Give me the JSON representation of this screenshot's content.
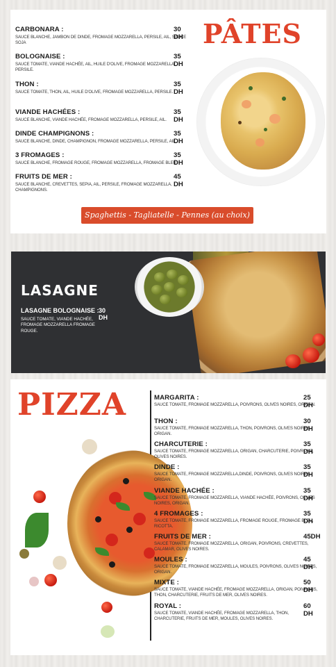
{
  "pates": {
    "title": "PÂTES",
    "items": [
      {
        "name": "CARBONARA :",
        "price": "30 DH",
        "desc": "SAUCE BLANCHE, JAMBON DE DINDE, FROMAGE MOZZARELLA, PERSILE, AIL, SAUCE SOJA"
      },
      {
        "name": "BOLOGNAISE :",
        "price": "35 DH",
        "desc": "SAUCE TOMATE, VIANDE HACHÉE, AIL, HUILE D'OLIVE, FROMAGE MOZZARELLA, PERSILE."
      },
      {
        "name": "THON :",
        "price": "35 DH",
        "desc": "SAUCE TOMATE, THON, AIL, HUILE D'OLIVE, FROMAGE MOZZARELLA, PERSILE."
      },
      {
        "name": "VIANDE HACHÉES :",
        "price": "35 DH",
        "desc": "SAUCE BLANCHE, VIANDE HACHÉE, FROMAGE MOZZARELLA, PERSILE, AIL."
      },
      {
        "name": "DINDE CHAMPIGNONS :",
        "price": "35 DH",
        "desc": "SAUCE BLANCHE, DINDE, CHAMPIGNON, FROMAGE MOZZARELLA, PERSILE, AIL."
      },
      {
        "name": "3 FROMAGES :",
        "price": "35 DH",
        "desc": "SAUCE BLANCHE, FROMAGE ROUGE, FROMAGE MOZZARELLA, FROMAGE BLEU."
      },
      {
        "name": "FRUITS DE MER :",
        "price": "45 DH",
        "desc": "SAUCE BLANCHE, CREVETTES, SEPIA, AIL, PERSILE, FROMAGE MOZZARELLA, CHAMPIGNONS."
      }
    ],
    "choice": "Spaghettis - Tagliatelle - Pennes (au choix)"
  },
  "lasagne": {
    "title": "LASAGNE",
    "item": {
      "name": "LASAGNE BOLOGNAISE :",
      "price": "30 DH",
      "desc": "SAUCE TOMATE, VIANDE HACHÉE, FROMAGE MOZZARELLA FROMAGE ROUGE."
    }
  },
  "pizza": {
    "title": "PIZZA",
    "items": [
      {
        "name": "MARGARITA :",
        "price": "25 DH",
        "desc": "SAUCE TOMATE, FROMAGE MOZZARELLA, POIVRONS, OLIVES NOIRES, ORIGAN."
      },
      {
        "name": "THON :",
        "price": "30 DH",
        "desc": "SAUCE TOMATE, FROMAGE MOZZARELLA, THON, POIVRONS, OLIVES NOIRES, ORIGAN."
      },
      {
        "name": "CHARCUTERIE :",
        "price": "35 DH",
        "desc": "SAUCE TOMATE, FROMAGE MOZZARELLA, ORIGAN, CHARCUTERIE, POIVRONS, OLIVES NOIRES."
      },
      {
        "name": "DINDE :",
        "price": "35 DH",
        "desc": "SAUCE TOMATE, FROMAGE MOZZARELLA,DINDE, POIVRONS, OLIVES NOIRES, ORIGAN."
      },
      {
        "name": "VIANDE HACHÉE :",
        "price": "35 DH",
        "desc": "SAUCE TOMATE, FROMAGE MOZZARELLA, VIANDE HACHÉE, POIVRONS, OLIVES NOIRES, ORIGAN."
      },
      {
        "name": "4 FROMAGES :",
        "price": "35 DH",
        "desc": "SAUCE TOMATE, FROMAGE MOZZARELLA, FROMAGE ROUGE, FROMAGE BLEU, RICOTTA."
      },
      {
        "name": "FRUITS DE MER :",
        "price": "45DH",
        "desc": "SAUCE TOMATE, FROMAGE MOZZARELLA, ORIGAN, POIVRONS, CREVETTES, CALAMAR, OLIVES NOIRES."
      },
      {
        "name": "MOULES :",
        "price": "45 DH",
        "desc": "SAUCE TOMATE, FROMAGE MOZZARELLA, MOULES, POIVRONS, OLIVES NOIRES, ORIGAN."
      },
      {
        "name": "MIXTE :",
        "price": "50 DH",
        "desc": "SAUCE TOMATE, VIANDE HACHÉE, FROMAGE MOZZARELLA, ORIGAN, POIVRONS, THON, CHARCUTERIE, FRUITS DE MER, OLIVES NOIRES."
      },
      {
        "name": "ROYAL :",
        "price": "60 DH",
        "desc": "SAUCE TOMATE, VIANDE HACHÉE, FROMAGE MOZZARELLA, THON, CHARCUTERIE, FRUITS DE MER, MOULES, OLIVES NOIRES."
      }
    ]
  },
  "colors": {
    "accent": "#e0432a",
    "banner": "#2f3033",
    "choice_bar": "#d94c2b"
  }
}
